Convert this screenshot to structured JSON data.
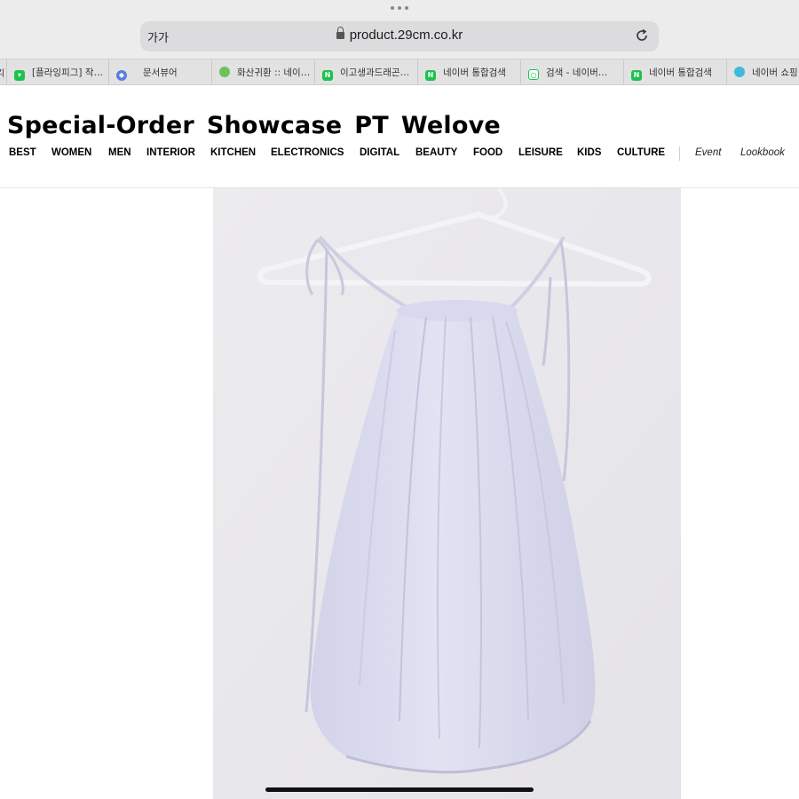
{
  "browser": {
    "reader_label": "가가",
    "url": "product.29cm.co.kr",
    "tabs": [
      {
        "label": "[플라잉피그] 작…",
        "icon": "green-shield-icon"
      },
      {
        "label": "문서뷰어",
        "icon": "blue-hex-icon"
      },
      {
        "label": "화산귀환 :: 네이…",
        "icon": "green-circle-icon"
      },
      {
        "label": "이고생과드래곤…",
        "icon": "naver-icon"
      },
      {
        "label": "네이버 통합검색",
        "icon": "naver-icon"
      },
      {
        "label": "검색 - 네이버…",
        "icon": "naver-search-icon"
      },
      {
        "label": "네이버 통합검색",
        "icon": "naver-icon"
      },
      {
        "label": "네이버 쇼핑",
        "icon": "naver-shopping-icon"
      }
    ]
  },
  "site": {
    "brand_words": [
      "Special-Order",
      "Showcase",
      "PT",
      "Welove"
    ],
    "nav": [
      "BEST",
      "WOMEN",
      "MEN",
      "INTERIOR",
      "KITCHEN",
      "ELECTRONICS",
      "DIGITAL",
      "BEAUTY",
      "FOOD",
      "LEISURE",
      "KIDS",
      "CULTURE"
    ],
    "nav_secondary": [
      "Event",
      "Lookbook"
    ]
  },
  "colors": {
    "naver_green": "#19c34c",
    "product_lilac": "#d9d9ef",
    "wall": "#e9e8ec"
  }
}
